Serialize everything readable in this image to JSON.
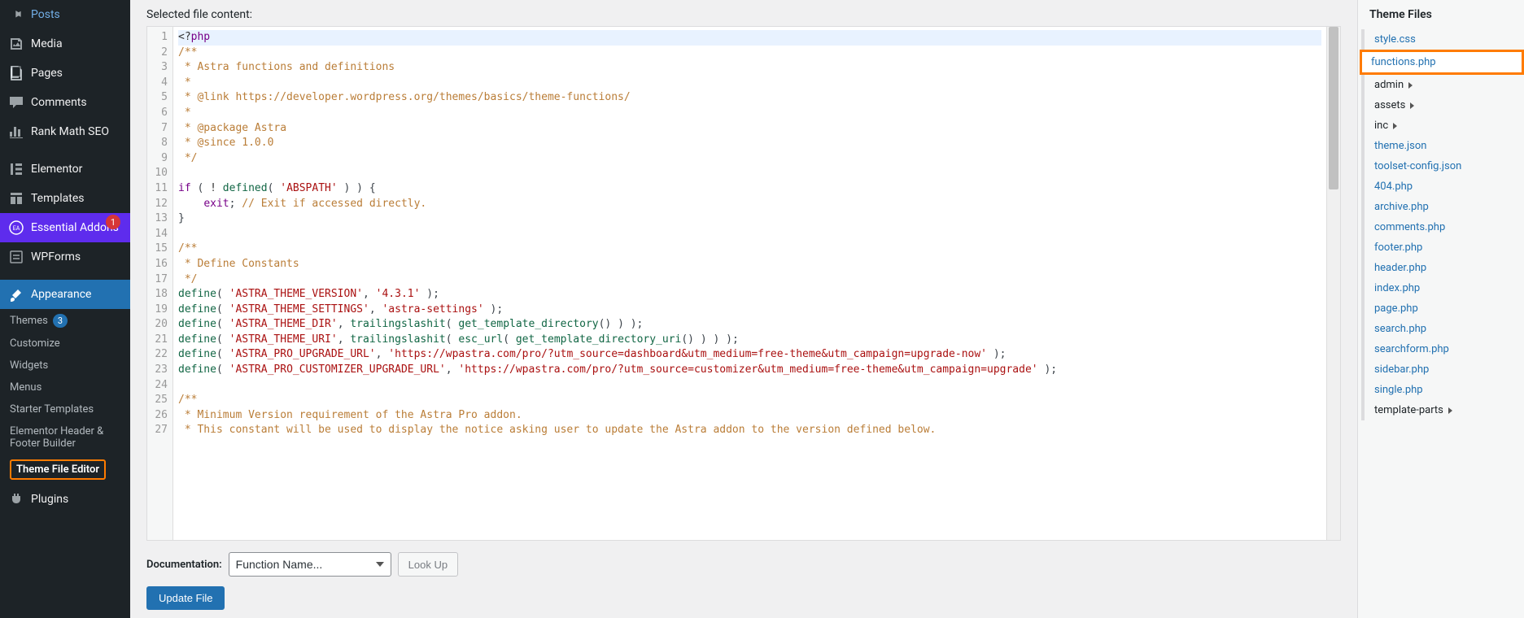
{
  "sidebar": {
    "items": [
      {
        "icon": "pin",
        "label": "Posts"
      },
      {
        "icon": "media",
        "label": "Media"
      },
      {
        "icon": "page",
        "label": "Pages"
      },
      {
        "icon": "comment",
        "label": "Comments"
      },
      {
        "icon": "graph",
        "label": "Rank Math SEO"
      }
    ],
    "items2": [
      {
        "icon": "elementor",
        "label": "Elementor"
      },
      {
        "icon": "templates",
        "label": "Templates"
      },
      {
        "icon": "ea",
        "label": "Essential Addons",
        "badge": "1"
      },
      {
        "icon": "wpforms",
        "label": "WPForms"
      }
    ],
    "appearance": {
      "icon": "brush",
      "label": "Appearance"
    },
    "submenu": [
      {
        "label": "Themes",
        "count": "3"
      },
      {
        "label": "Customize"
      },
      {
        "label": "Widgets"
      },
      {
        "label": "Menus"
      },
      {
        "label": "Starter Templates"
      },
      {
        "label": "Elementor Header & Footer Builder"
      },
      {
        "label": "Theme File Editor",
        "current": true
      }
    ],
    "plugins": {
      "icon": "plug",
      "label": "Plugins"
    }
  },
  "main": {
    "heading": "Selected file content:",
    "doc_label": "Documentation:",
    "doc_placeholder": "Function Name...",
    "lookup_label": "Look Up",
    "update_label": "Update File"
  },
  "code": {
    "lines": [
      {
        "n": 1,
        "html": "<span class='c-p'>&lt;?</span><span class='c-k'>php</span>"
      },
      {
        "n": 2,
        "html": "<span class='c-c'>/**</span>"
      },
      {
        "n": 3,
        "html": "<span class='c-c'> * Astra functions and definitions</span>"
      },
      {
        "n": 4,
        "html": "<span class='c-c'> *</span>"
      },
      {
        "n": 5,
        "html": "<span class='c-c'> * @link https://developer.wordpress.org/themes/basics/theme-functions/</span>"
      },
      {
        "n": 6,
        "html": "<span class='c-c'> *</span>"
      },
      {
        "n": 7,
        "html": "<span class='c-c'> * @package Astra</span>"
      },
      {
        "n": 8,
        "html": "<span class='c-c'> * @since 1.0.0</span>"
      },
      {
        "n": 9,
        "html": "<span class='c-c'> */</span>"
      },
      {
        "n": 10,
        "html": ""
      },
      {
        "n": 11,
        "html": "<span class='c-k'>if</span> ( <span class='c-p'>!</span> <span class='c-v'>defined</span>( <span class='c-s'>'ABSPATH'</span> ) ) {"
      },
      {
        "n": 12,
        "html": "    <span class='c-k'>exit</span>; <span class='c-c'>// Exit if accessed directly.</span>"
      },
      {
        "n": 13,
        "html": "}"
      },
      {
        "n": 14,
        "html": ""
      },
      {
        "n": 15,
        "html": "<span class='c-c'>/**</span>"
      },
      {
        "n": 16,
        "html": "<span class='c-c'> * Define Constants</span>"
      },
      {
        "n": 17,
        "html": "<span class='c-c'> */</span>"
      },
      {
        "n": 18,
        "html": "<span class='c-v'>define</span>( <span class='c-s'>'ASTRA_THEME_VERSION'</span>, <span class='c-s'>'4.3.1'</span> );"
      },
      {
        "n": 19,
        "html": "<span class='c-v'>define</span>( <span class='c-s'>'ASTRA_THEME_SETTINGS'</span>, <span class='c-s'>'astra-settings'</span> );"
      },
      {
        "n": 20,
        "html": "<span class='c-v'>define</span>( <span class='c-s'>'ASTRA_THEME_DIR'</span>, <span class='c-v'>trailingslashit</span>( <span class='c-v'>get_template_directory</span>() ) );"
      },
      {
        "n": 21,
        "html": "<span class='c-v'>define</span>( <span class='c-s'>'ASTRA_THEME_URI'</span>, <span class='c-v'>trailingslashit</span>( <span class='c-v'>esc_url</span>( <span class='c-v'>get_template_directory_uri</span>() ) ) );"
      },
      {
        "n": 22,
        "html": "<span class='c-v'>define</span>( <span class='c-s'>'ASTRA_PRO_UPGRADE_URL'</span>, <span class='c-s'>'https://wpastra.com/pro/?utm_source=dashboard&amp;utm_medium=free-theme&amp;utm_campaign=upgrade-now'</span> );"
      },
      {
        "n": 23,
        "html": "<span class='c-v'>define</span>( <span class='c-s'>'ASTRA_PRO_CUSTOMIZER_UPGRADE_URL'</span>, <span class='c-s'>'https://wpastra.com/pro/?utm_source=customizer&amp;utm_medium=free-theme&amp;utm_campaign=upgrade'</span> );"
      },
      {
        "n": 24,
        "html": ""
      },
      {
        "n": 25,
        "html": "<span class='c-c'>/**</span>"
      },
      {
        "n": 26,
        "html": "<span class='c-c'> * Minimum Version requirement of the Astra Pro addon.</span>"
      },
      {
        "n": 27,
        "html": "<span class='c-c'> * This constant will be used to display the notice asking user to update the Astra addon to the version defined below.</span>"
      }
    ]
  },
  "files": {
    "heading": "Theme Files",
    "list": [
      {
        "type": "file",
        "label": "style.css"
      },
      {
        "type": "file",
        "label": "functions.php",
        "selected": true
      },
      {
        "type": "folder",
        "label": "admin"
      },
      {
        "type": "folder",
        "label": "assets"
      },
      {
        "type": "folder",
        "label": "inc"
      },
      {
        "type": "file",
        "label": "theme.json"
      },
      {
        "type": "file",
        "label": "toolset-config.json"
      },
      {
        "type": "file",
        "label": "404.php"
      },
      {
        "type": "file",
        "label": "archive.php"
      },
      {
        "type": "file",
        "label": "comments.php"
      },
      {
        "type": "file",
        "label": "footer.php"
      },
      {
        "type": "file",
        "label": "header.php"
      },
      {
        "type": "file",
        "label": "index.php"
      },
      {
        "type": "file",
        "label": "page.php"
      },
      {
        "type": "file",
        "label": "search.php"
      },
      {
        "type": "file",
        "label": "searchform.php"
      },
      {
        "type": "file",
        "label": "sidebar.php"
      },
      {
        "type": "file",
        "label": "single.php"
      },
      {
        "type": "folder",
        "label": "template-parts"
      }
    ]
  }
}
